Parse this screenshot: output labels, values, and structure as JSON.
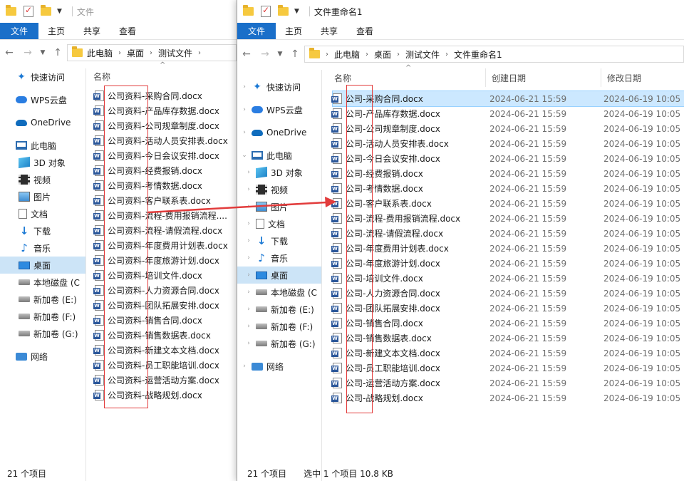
{
  "left": {
    "title": "文件",
    "tabs": [
      "文件",
      "主页",
      "共享",
      "查看"
    ],
    "header": {
      "name": "名称"
    },
    "nav": [
      {
        "label": "快速访问",
        "icon": "star-icon"
      },
      {
        "label": "WPS云盘",
        "icon": "cloud-icon"
      },
      {
        "label": "OneDrive",
        "icon": "onedrive-icon"
      },
      {
        "label": "此电脑",
        "icon": "computer-icon"
      },
      {
        "label": "3D 对象",
        "icon": "cube-icon"
      },
      {
        "label": "视频",
        "icon": "film-icon"
      },
      {
        "label": "图片",
        "icon": "picture-icon"
      },
      {
        "label": "文档",
        "icon": "document-icon"
      },
      {
        "label": "下载",
        "icon": "download-icon"
      },
      {
        "label": "音乐",
        "icon": "music-icon"
      },
      {
        "label": "桌面",
        "icon": "desktop-icon"
      },
      {
        "label": "本地磁盘 (C",
        "icon": "drive-icon"
      },
      {
        "label": "新加卷 (E:)",
        "icon": "drive-icon"
      },
      {
        "label": "新加卷 (F:)",
        "icon": "drive-icon"
      },
      {
        "label": "新加卷 (G:)",
        "icon": "drive-icon"
      },
      {
        "label": "网络",
        "icon": "network-icon"
      }
    ],
    "files": [
      "公司资料-采购合同.docx",
      "公司资料-产品库存数据.docx",
      "公司资料-公司规章制度.docx",
      "公司资料-活动人员安排表.docx",
      "公司资料-今日会议安排.docx",
      "公司资料-经费报销.docx",
      "公司资料-考情数据.docx",
      "公司资料-客户联系表.docx",
      "公司资料-流程-费用报销流程....",
      "公司资料-流程-请假流程.docx",
      "公司资料-年度费用计划表.docx",
      "公司资料-年度旅游计划.docx",
      "公司资料-培训文件.docx",
      "公司资料-人力资源合同.docx",
      "公司资料-团队拓展安排.docx",
      "公司资料-销售合同.docx",
      "公司资料-销售数据表.docx",
      "公司资料-新建文本文档.docx",
      "公司资料-员工职能培训.docx",
      "公司资料-运营活动方案.docx",
      "公司资料-战略规划.docx"
    ],
    "status": "21 个项目"
  },
  "right": {
    "title": "文件重命名1",
    "tabs": [
      "文件",
      "主页",
      "共享",
      "查看"
    ],
    "breadcrumb": [
      "此电脑",
      "桌面",
      "测试文件",
      "文件重命名1"
    ],
    "header": {
      "name": "名称",
      "created": "创建日期",
      "modified": "修改日期"
    },
    "nav": [
      {
        "label": "快速访问",
        "icon": "star-icon"
      },
      {
        "label": "WPS云盘",
        "icon": "cloud-icon"
      },
      {
        "label": "OneDrive",
        "icon": "onedrive-icon"
      },
      {
        "label": "此电脑",
        "icon": "computer-icon"
      },
      {
        "label": "3D 对象",
        "icon": "cube-icon"
      },
      {
        "label": "视频",
        "icon": "film-icon"
      },
      {
        "label": "图片",
        "icon": "picture-icon"
      },
      {
        "label": "文档",
        "icon": "document-icon"
      },
      {
        "label": "下载",
        "icon": "download-icon"
      },
      {
        "label": "音乐",
        "icon": "music-icon"
      },
      {
        "label": "桌面",
        "icon": "desktop-icon"
      },
      {
        "label": "本地磁盘 (C",
        "icon": "drive-icon"
      },
      {
        "label": "新加卷 (E:)",
        "icon": "drive-icon"
      },
      {
        "label": "新加卷 (F:)",
        "icon": "drive-icon"
      },
      {
        "label": "新加卷 (G:)",
        "icon": "drive-icon"
      },
      {
        "label": "网络",
        "icon": "network-icon"
      }
    ],
    "files": [
      {
        "name": "公司-采购合同.docx",
        "created": "2024-06-21 15:59",
        "modified": "2024-06-19 10:05"
      },
      {
        "name": "公司-产品库存数据.docx",
        "created": "2024-06-21 15:59",
        "modified": "2024-06-19 10:05"
      },
      {
        "name": "公司-公司规章制度.docx",
        "created": "2024-06-21 15:59",
        "modified": "2024-06-19 10:05"
      },
      {
        "name": "公司-活动人员安排表.docx",
        "created": "2024-06-21 15:59",
        "modified": "2024-06-19 10:05"
      },
      {
        "name": "公司-今日会议安排.docx",
        "created": "2024-06-21 15:59",
        "modified": "2024-06-19 10:05"
      },
      {
        "name": "公司-经费报销.docx",
        "created": "2024-06-21 15:59",
        "modified": "2024-06-19 10:05"
      },
      {
        "name": "公司-考情数据.docx",
        "created": "2024-06-21 15:59",
        "modified": "2024-06-19 10:05"
      },
      {
        "name": "公司-客户联系表.docx",
        "created": "2024-06-21 15:59",
        "modified": "2024-06-19 10:05"
      },
      {
        "name": "公司-流程-费用报销流程.docx",
        "created": "2024-06-21 15:59",
        "modified": "2024-06-19 10:05"
      },
      {
        "name": "公司-流程-请假流程.docx",
        "created": "2024-06-21 15:59",
        "modified": "2024-06-19 10:05"
      },
      {
        "name": "公司-年度费用计划表.docx",
        "created": "2024-06-21 15:59",
        "modified": "2024-06-19 10:05"
      },
      {
        "name": "公司-年度旅游计划.docx",
        "created": "2024-06-21 15:59",
        "modified": "2024-06-19 10:05"
      },
      {
        "name": "公司-培训文件.docx",
        "created": "2024-06-21 15:59",
        "modified": "2024-06-19 10:05"
      },
      {
        "name": "公司-人力资源合同.docx",
        "created": "2024-06-21 15:59",
        "modified": "2024-06-19 10:05"
      },
      {
        "name": "公司-团队拓展安排.docx",
        "created": "2024-06-21 15:59",
        "modified": "2024-06-19 10:05"
      },
      {
        "name": "公司-销售合同.docx",
        "created": "2024-06-21 15:59",
        "modified": "2024-06-19 10:05"
      },
      {
        "name": "公司-销售数据表.docx",
        "created": "2024-06-21 15:59",
        "modified": "2024-06-19 10:05"
      },
      {
        "name": "公司-新建文本文档.docx",
        "created": "2024-06-21 15:59",
        "modified": "2024-06-19 10:05"
      },
      {
        "name": "公司-员工职能培训.docx",
        "created": "2024-06-21 15:59",
        "modified": "2024-06-19 10:05"
      },
      {
        "name": "公司-运营活动方案.docx",
        "created": "2024-06-21 15:59",
        "modified": "2024-06-19 10:05"
      },
      {
        "name": "公司-战略规划.docx",
        "created": "2024-06-21 15:59",
        "modified": "2024-06-19 10:05"
      }
    ],
    "status": {
      "count": "21 个项目",
      "selected": "选中 1 个项目 10.8 KB"
    }
  },
  "colors": {
    "accent": "#1a6fc9",
    "selection": "#cce8ff",
    "annotation": "#e23c3c"
  }
}
